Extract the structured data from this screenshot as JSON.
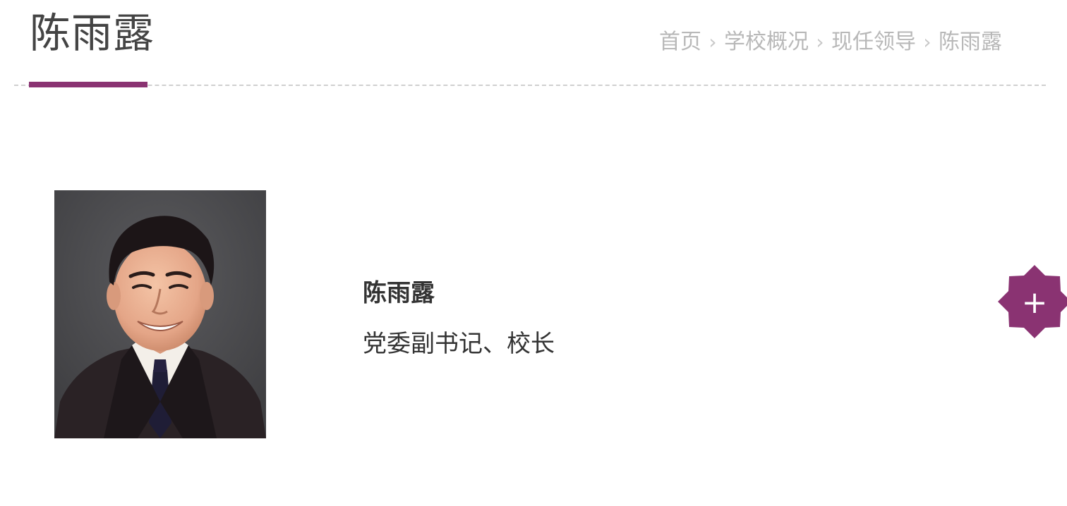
{
  "header": {
    "title": "陈雨露",
    "breadcrumb": [
      {
        "label": "首页"
      },
      {
        "label": "学校概况"
      },
      {
        "label": "现任领导"
      },
      {
        "label": "陈雨露"
      }
    ],
    "separator": ">"
  },
  "profile": {
    "name": "陈雨露",
    "position": "党委副书记、校长"
  },
  "expand_button": {
    "symbol": "+",
    "icon": "plus-icon"
  },
  "colors": {
    "accent": "#8a3372",
    "breadcrumb_text": "#b8b8b8",
    "title_text": "#444444",
    "body_text": "#333333"
  }
}
